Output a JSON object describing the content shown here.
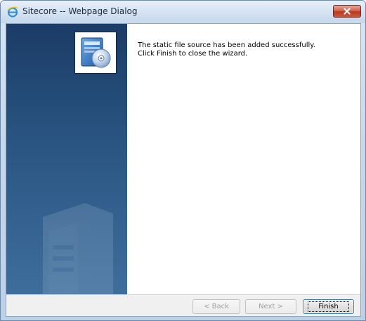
{
  "window": {
    "title": "Sitecore -- Webpage Dialog",
    "icon": "internet-explorer-icon",
    "close_icon": "close-icon"
  },
  "sidebar": {
    "image_icon": "wizard-installer-icon",
    "watermark_icon": "server-watermark-icon"
  },
  "message": {
    "line1": "The static file source has been added successfully.",
    "line2": "Click Finish to close the wizard."
  },
  "buttons": {
    "back": "< Back",
    "next": "Next >",
    "finish": "Finish"
  },
  "colors": {
    "sidebar_top": "#1b3c66",
    "sidebar_bottom": "#3f6e9c",
    "close_button": "#c9573f",
    "focus_border": "#3c7fb1"
  }
}
